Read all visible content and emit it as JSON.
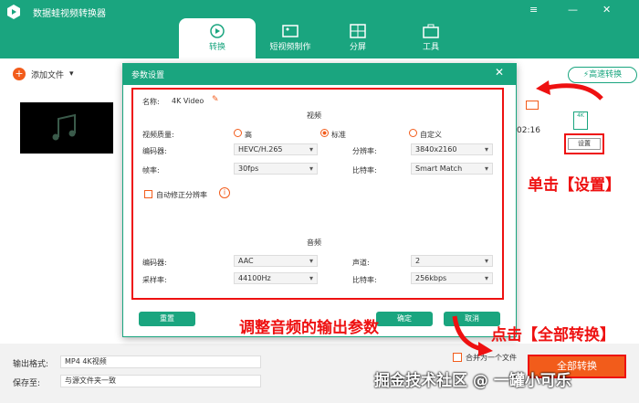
{
  "app": {
    "title": "数据蛙视频转换器"
  },
  "tabs": [
    {
      "label": "转换"
    },
    {
      "label": "短视频制作"
    },
    {
      "label": "分屏"
    },
    {
      "label": "工具"
    }
  ],
  "toolbar": {
    "add_file": "添加文件",
    "fast_convert": "高速转换"
  },
  "file": {
    "time": "02:16",
    "settings_label": "设置",
    "format_badge": "4K"
  },
  "bottom": {
    "out_format_label": "输出格式:",
    "out_format_value": "MP4 4K视频",
    "save_label": "保存至:",
    "save_value": "与源文件夹一致",
    "convert_all": "全部转换",
    "merge": "合并为一个文件"
  },
  "dialog": {
    "title": "参数设置",
    "name_label": "名称:",
    "name_value": "4K Video",
    "video_section": "视频",
    "quality_label": "视频质量:",
    "quality_options": [
      "高",
      "标准",
      "自定义"
    ],
    "encoder_label": "编码器:",
    "encoder_value": "HEVC/H.265",
    "resolution_label": "分辨率:",
    "resolution_value": "3840x2160",
    "fps_label": "帧率:",
    "fps_value": "30fps",
    "bitrate_label": "比特率:",
    "bitrate_value": "Smart Match",
    "auto_res": "自动修正分辨率",
    "audio_section": "音频",
    "a_encoder_label": "编码器:",
    "a_encoder_value": "AAC",
    "channel_label": "声道:",
    "channel_value": "2",
    "samplerate_label": "采样率:",
    "samplerate_value": "44100Hz",
    "a_bitrate_label": "比特率:",
    "a_bitrate_value": "256kbps",
    "reset": "重置",
    "ok": "确定",
    "cancel": "取消"
  },
  "annotations": {
    "click_settings": "单击【设置】",
    "adjust_audio": "调整音频的输出参数",
    "click_convert": "点击【全部转换】"
  },
  "watermark": "掘金技术社区 @ 一罐小可乐",
  "colors": {
    "brand": "#1aa57f",
    "accent": "#f25c1b",
    "annotation": "#e11111"
  }
}
